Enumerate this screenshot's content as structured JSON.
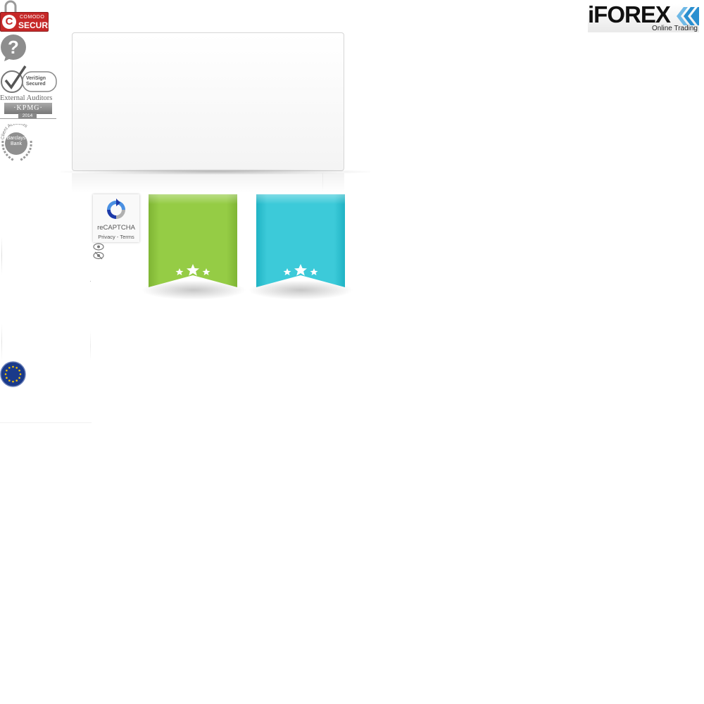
{
  "logo": {
    "wordmark": "iFOREX",
    "tagline": "Online Trading",
    "colors": {
      "text": "#111111",
      "chevron": "#2a8fd0"
    }
  },
  "security_badges": {
    "comodo": {
      "line1": "COMODO",
      "line2": "SECURE",
      "letter": "C",
      "color": "#c62828"
    },
    "help": {
      "symbol": "?"
    },
    "verisign": {
      "line1": "VeriSign",
      "line2": "Secured"
    },
    "auditors": {
      "label": "External Auditors",
      "brand": "·KPMG·",
      "year": "2014"
    },
    "barclays": {
      "arc": "Client Accounts",
      "line1": "Barclays",
      "line2": "Bank"
    },
    "eu": {
      "icon": "eu-flag-icon"
    }
  },
  "form_panel": {},
  "recaptcha": {
    "label": "reCAPTCHA",
    "privacy": "Privacy",
    "separator": " - ",
    "terms": "Terms"
  },
  "ribbons": [
    {
      "name": "green-ribbon",
      "color": "#8cc43d",
      "stars": 3
    },
    {
      "name": "blue-ribbon",
      "color": "#30c6d6",
      "stars": 3
    }
  ]
}
